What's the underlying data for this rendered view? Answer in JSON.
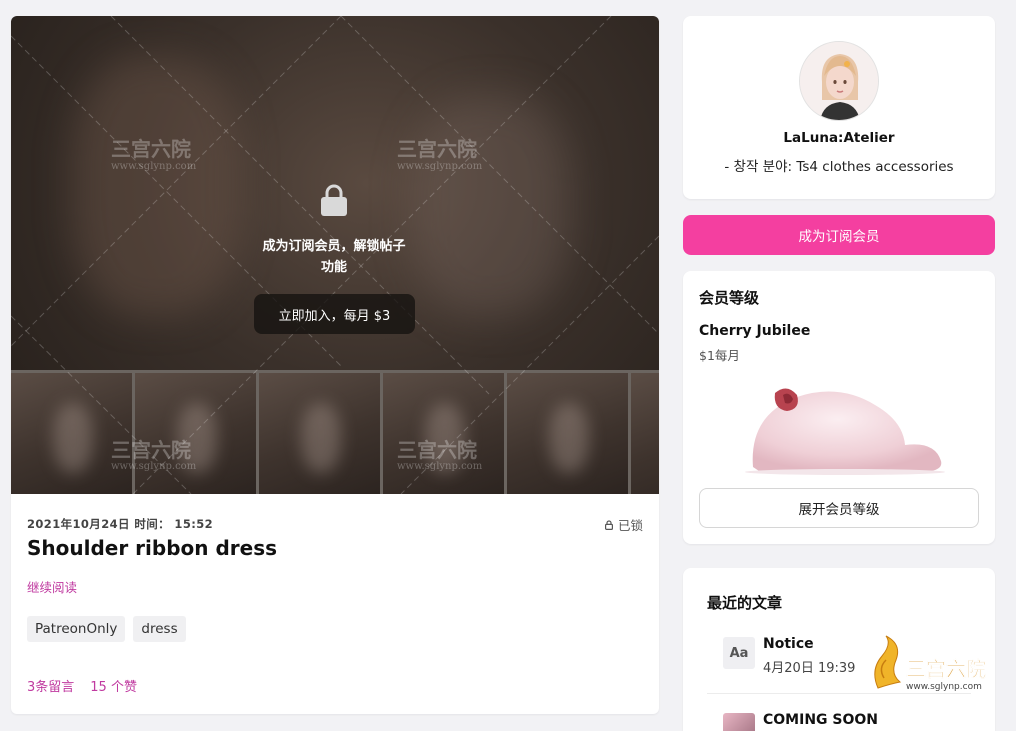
{
  "post": {
    "lock_text_line1": "成为订阅会员，解锁帖子",
    "lock_text_line2": "功能",
    "join_label": "立即加入，每月 $3",
    "date": "2021年10月24日 时间： 15:52",
    "locked_label": "已锁",
    "title": "Shoulder ribbon dress",
    "read_more": "继续阅读",
    "tags": [
      "PatreonOnly",
      "dress"
    ],
    "comments": "3条留言",
    "likes": "15 个赞",
    "watermark_text": "三宫六院",
    "watermark_url": "www.sglynp.com"
  },
  "creator": {
    "name": "LaLuna:Atelier",
    "description": "- 창작 분야: Ts4 clothes accessories"
  },
  "subscribe_label": "成为订阅会员",
  "tiers": {
    "heading": "会员等级",
    "name": "Cherry Jubilee",
    "price": "$1每月",
    "expand_label": "展开会员等级"
  },
  "recent": {
    "heading": "最近的文章",
    "items": [
      {
        "title": "Notice",
        "time": "4月20日 19:39",
        "thumb": "Aa"
      },
      {
        "title": "COMING SOON",
        "time": "",
        "thumb": ""
      }
    ]
  },
  "corner_watermark": {
    "text": "三宫六院",
    "url": "www.sglynp.com"
  },
  "colors": {
    "accent": "#f43fa0",
    "link": "#c03aa0",
    "background": "#f2f2f5"
  }
}
